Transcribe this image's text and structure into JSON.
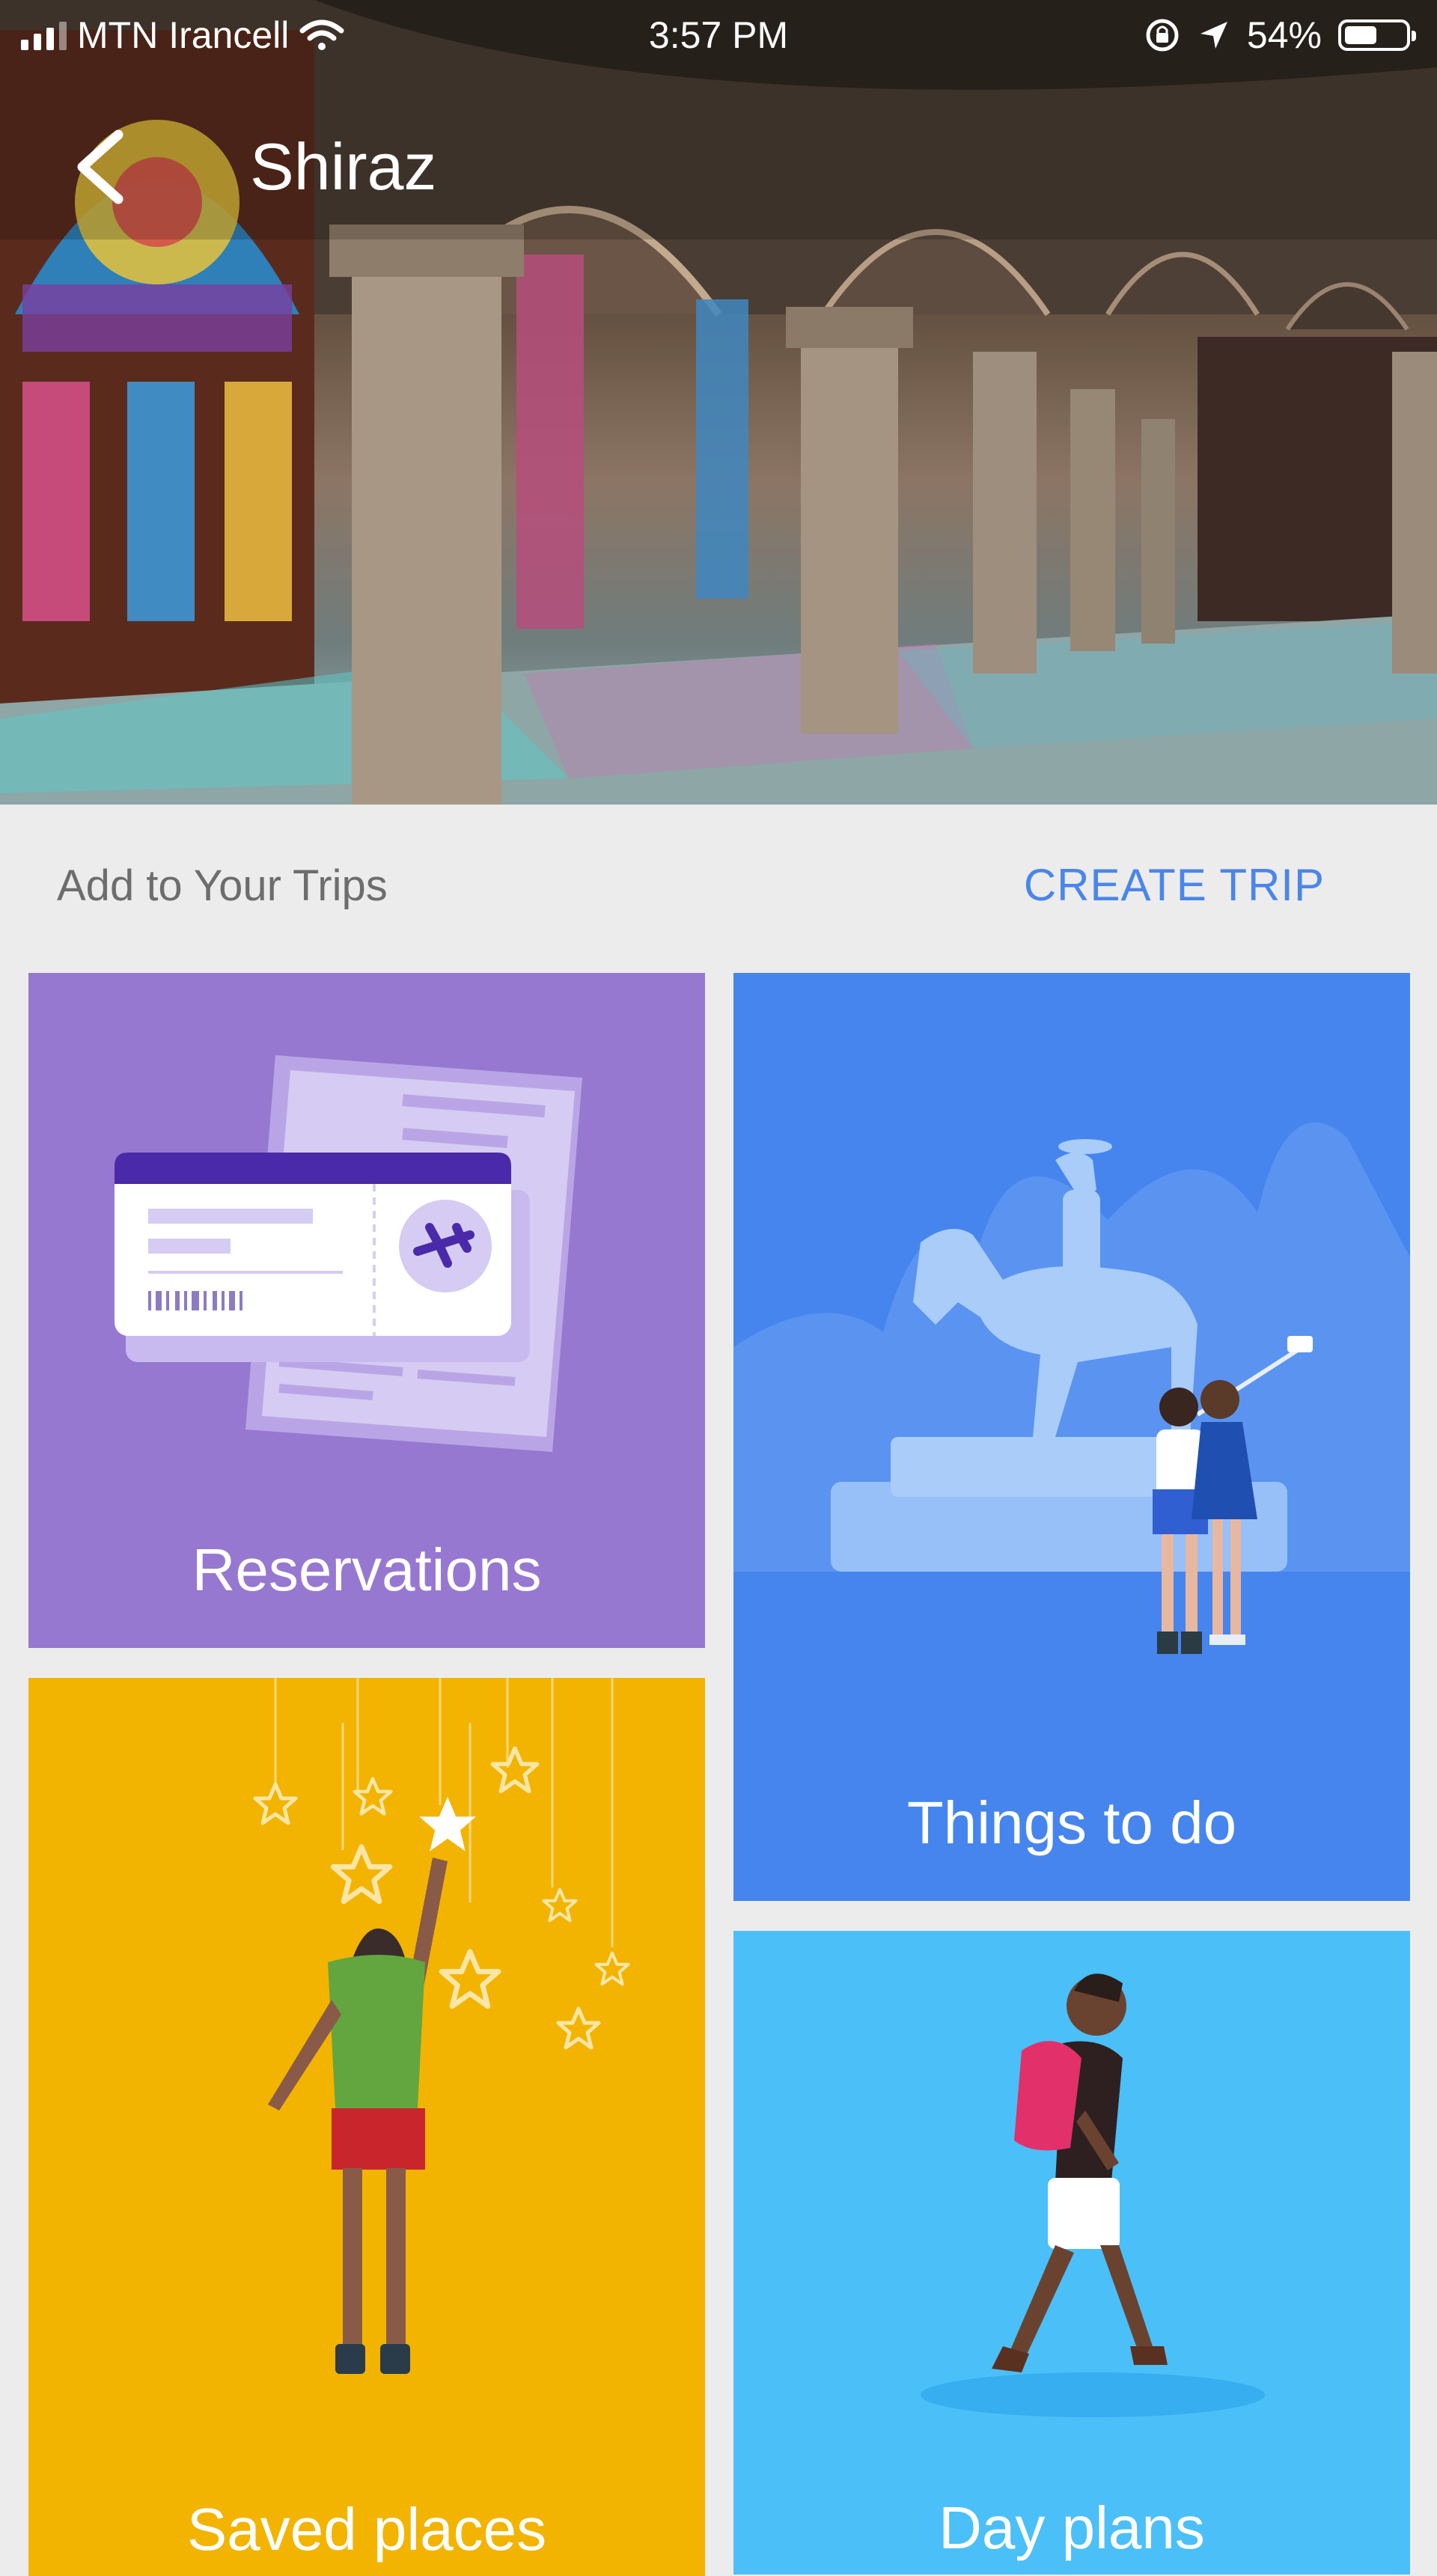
{
  "status_bar": {
    "carrier": "MTN Irancell",
    "time": "3:57 PM",
    "battery": "54%",
    "battery_level": 0.54
  },
  "header": {
    "title": "Shiraz"
  },
  "trips": {
    "label": "Add to Your Trips",
    "create_button": "CREATE TRIP"
  },
  "cards": {
    "reservations": "Reservations",
    "things_to_do": "Things to do",
    "saved_places": "Saved places",
    "day_plans": "Day plans"
  },
  "colors": {
    "reservations": "#9778d0",
    "things_to_do": "#4685ee",
    "saved_places": "#f2b400",
    "day_plans": "#4bbff7",
    "accent": "#4a86ea"
  },
  "icons": [
    "cellular-signal-icon",
    "wifi-icon",
    "rotation-lock-icon",
    "location-arrow-icon",
    "battery-icon",
    "back-arrow-icon"
  ]
}
